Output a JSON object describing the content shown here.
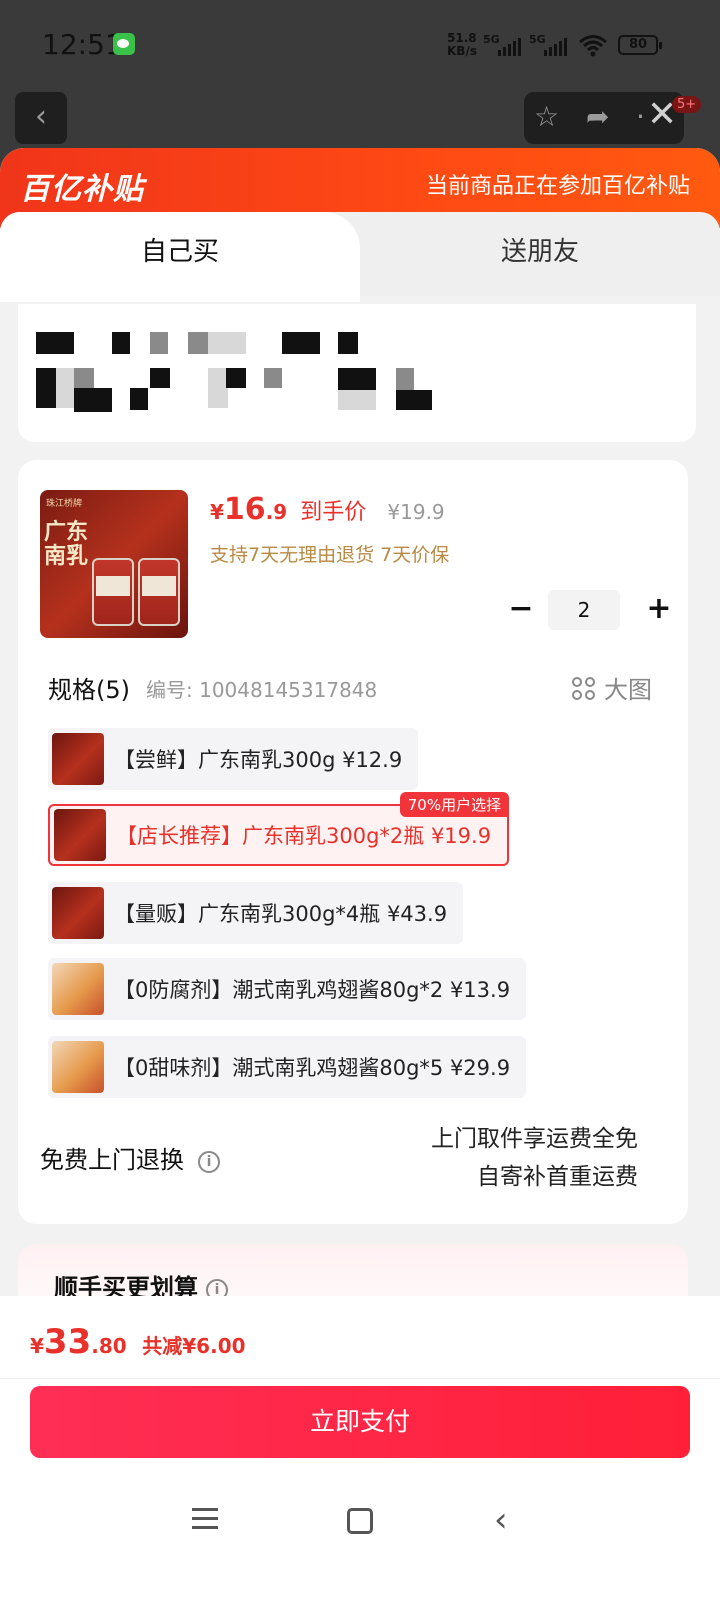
{
  "status": {
    "time": "12:51",
    "net_speed_top": "51.8",
    "net_speed_unit": "KB/s",
    "sim1": "5G",
    "sim2": "5G",
    "battery": "80"
  },
  "topnav": {
    "badge": "5+"
  },
  "banner": {
    "logo": "百亿补贴",
    "note": "当前商品正在参加百亿补贴"
  },
  "tabs": {
    "self": "自己买",
    "friend": "送朋友"
  },
  "product": {
    "thumb_title": "广东南乳",
    "thumb_brand": "珠江桥牌",
    "price_symbol": "¥",
    "price_int": "16",
    "price_dec": ".9",
    "price_label": "到手价",
    "original_price": "¥19.9",
    "promise": "支持7天无理由退货 7天价保",
    "quantity": "2",
    "minus": "−",
    "plus": "+"
  },
  "spec": {
    "title": "规格(5)",
    "code": "编号: 10048145317848",
    "big_image": "大图",
    "items": [
      {
        "text": "【尝鲜】广东南乳300g  ¥12.9",
        "selected": false,
        "tag": ""
      },
      {
        "text": "【店长推荐】广东南乳300g*2瓶  ¥19.9",
        "selected": true,
        "tag": "70%用户选择"
      },
      {
        "text": "【量贩】广东南乳300g*4瓶  ¥43.9",
        "selected": false,
        "tag": ""
      },
      {
        "text": "【0防腐剂】潮式南乳鸡翅酱80g*2  ¥13.9",
        "selected": false,
        "tag": ""
      },
      {
        "text": "【0甜味剂】潮式南乳鸡翅酱80g*5  ¥29.9",
        "selected": false,
        "tag": ""
      }
    ]
  },
  "returns": {
    "label": "免费上门退换",
    "info": "i",
    "line1": "上门取件享运费全免",
    "line2": "自寄补首重运费"
  },
  "combo": {
    "title": "顺手买更划算",
    "info": "i"
  },
  "pay": {
    "symbol": "¥",
    "int": "33",
    "dec": ".80",
    "saving": "共减¥6.00",
    "button": "立即支付"
  }
}
